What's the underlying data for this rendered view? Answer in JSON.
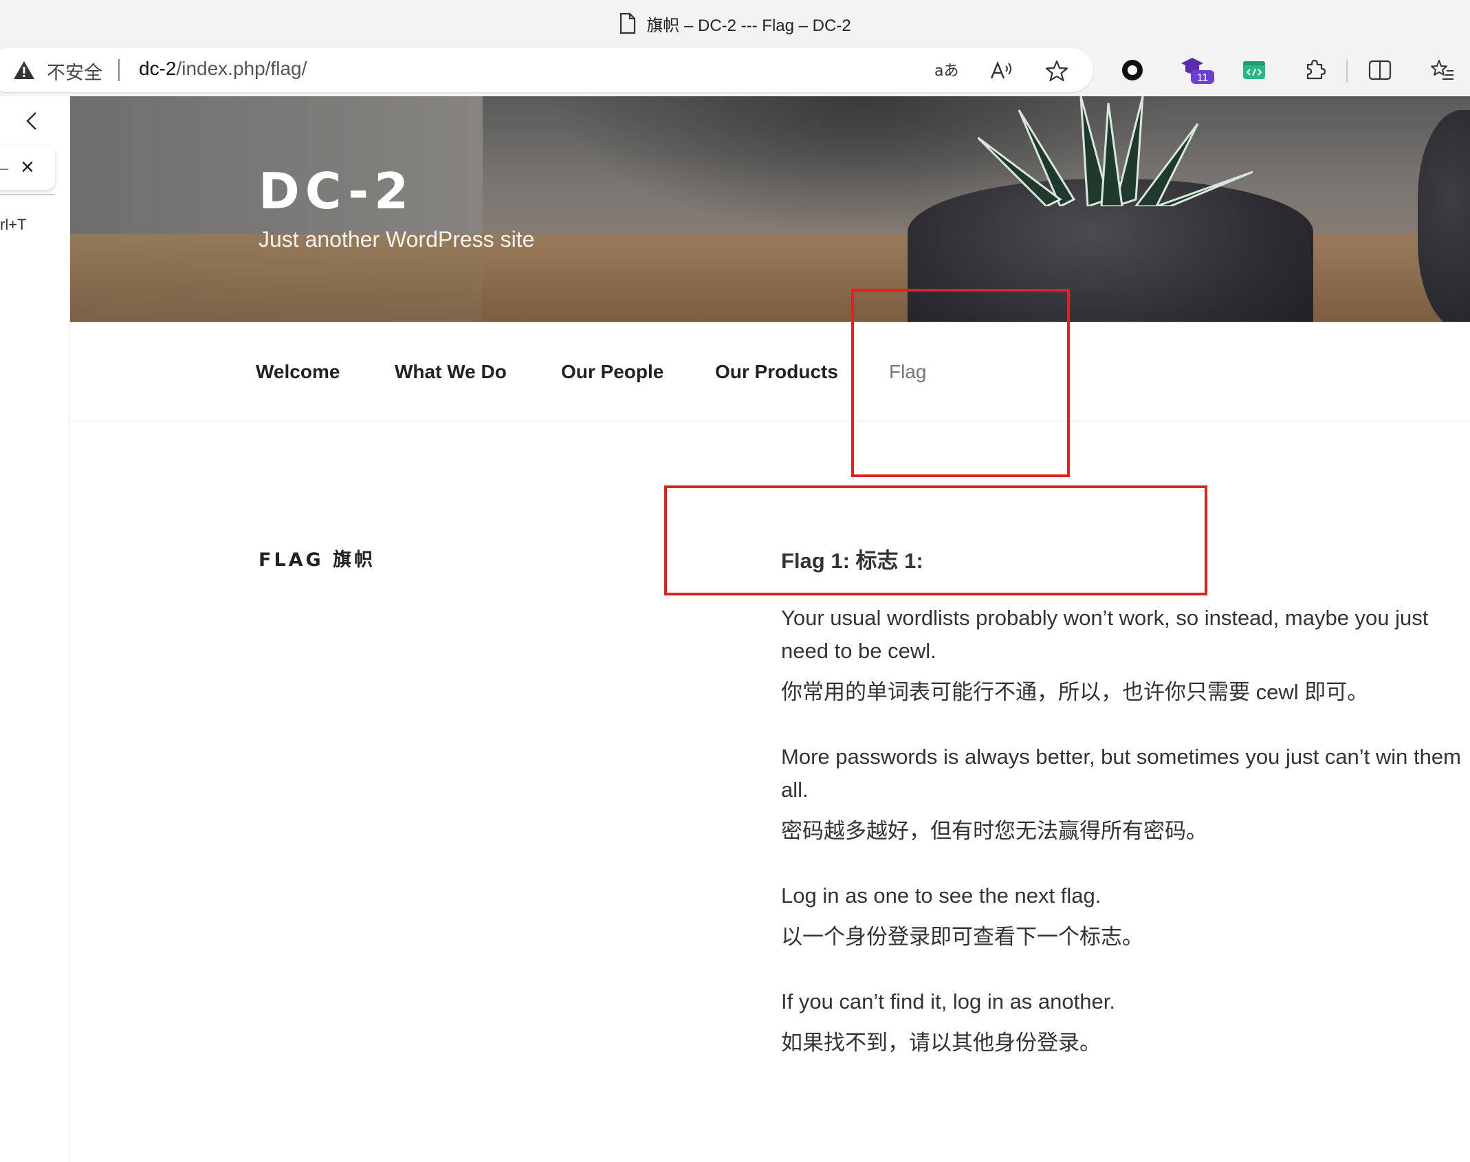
{
  "browser": {
    "tab_title": "旗帜 – DC-2 --- Flag – DC-2",
    "security_label": "不安全",
    "url_host": "dc-2",
    "url_path": "/index.php/flag/",
    "extension_badge": "11",
    "sidebar_shortcut": "rl+T"
  },
  "site": {
    "title": "DC-2",
    "description": "Just another WordPress site"
  },
  "nav": {
    "items": [
      {
        "label": "Welcome"
      },
      {
        "label": "What We Do"
      },
      {
        "label": "Our People"
      },
      {
        "label": "Our Products"
      },
      {
        "label": "Flag"
      }
    ],
    "current": "Flag"
  },
  "page": {
    "entry_title": "FLAG 旗帜",
    "heading": "Flag 1: 标志 1:",
    "paragraphs": [
      {
        "en": "Your usual wordlists probably won’t work, so instead, maybe you just need to be cewl.",
        "zh": "你常用的单词表可能行不通，所以，也许你只需要 cewl 即可。"
      },
      {
        "en": "More passwords is always better, but sometimes you just can’t win them all.",
        "zh": "密码越多越好，但有时您无法赢得所有密码。"
      },
      {
        "en": "Log in as one to see the next flag.",
        "zh": "以一个身份登录即可查看下一个标志。"
      },
      {
        "en": "If you can’t find it, log in as another.",
        "zh": "如果找不到，请以其他身份登录。"
      }
    ]
  },
  "colors": {
    "annotation_box": "#e32020",
    "nav_current": "#767676"
  }
}
